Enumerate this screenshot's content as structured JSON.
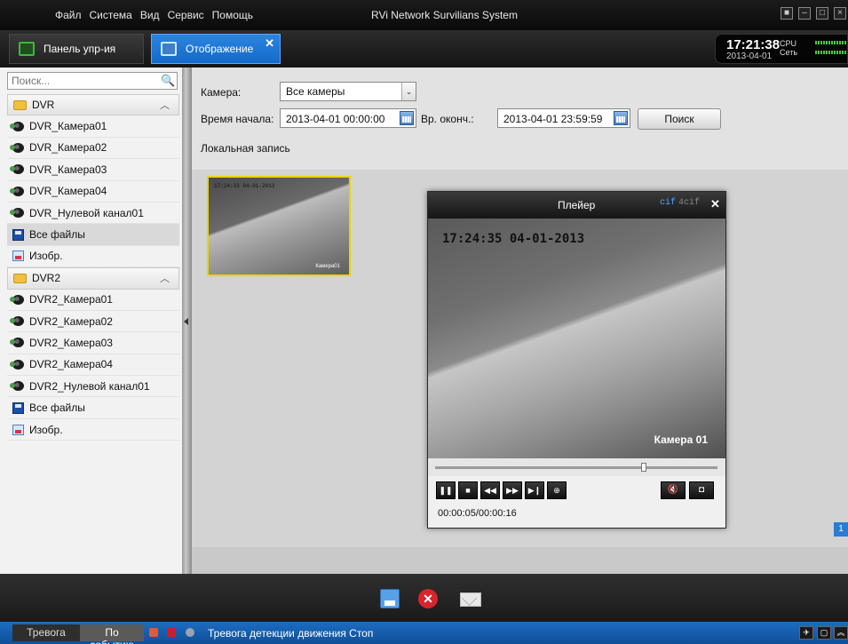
{
  "titlebar": {
    "menu": [
      "Файл",
      "Система",
      "Вид",
      "Сервис",
      "Помощь"
    ],
    "app_title": "RVi Network Survilians System"
  },
  "tabs": [
    {
      "label": "Панель упр-ия",
      "icon": "monitor-icon"
    },
    {
      "label": "Отображение",
      "icon": "display-icon",
      "active": true
    }
  ],
  "clock": {
    "time": "17:21:38",
    "date": "2013-04-01",
    "cpu_label": "CPU",
    "net_label": "Сеть"
  },
  "sidebar": {
    "search_placeholder": "Поиск...",
    "items": [
      {
        "label": "DVR",
        "type": "group"
      },
      {
        "label": "DVR_Камера01",
        "type": "camera"
      },
      {
        "label": "DVR_Камера02",
        "type": "camera"
      },
      {
        "label": "DVR_Камера03",
        "type": "camera"
      },
      {
        "label": "DVR_Камера04",
        "type": "camera"
      },
      {
        "label": "DVR_Нулевой канал01",
        "type": "camera"
      },
      {
        "label": "Все файлы",
        "type": "files",
        "selected": true
      },
      {
        "label": "Изобр.",
        "type": "images"
      },
      {
        "label": "DVR2",
        "type": "group"
      },
      {
        "label": "DVR2_Камера01",
        "type": "camera"
      },
      {
        "label": "DVR2_Камера02",
        "type": "camera"
      },
      {
        "label": "DVR2_Камера03",
        "type": "camera"
      },
      {
        "label": "DVR2_Камера04",
        "type": "camera"
      },
      {
        "label": "DVR2_Нулевой канал01",
        "type": "camera"
      },
      {
        "label": "Все файлы",
        "type": "files"
      },
      {
        "label": "Изобр.",
        "type": "images"
      }
    ]
  },
  "filter": {
    "camera_label": "Камера:",
    "camera_value": "Все камеры",
    "start_label": "Время начала:",
    "start_value": "2013-04-01 00:00:00",
    "end_label": "Вр. оконч.:",
    "end_value": "2013-04-01 23:59:59",
    "search_button": "Поиск",
    "section_title": "Локальная запись"
  },
  "thumbnail": {
    "osd": "17:24:33 04-01-2013",
    "camera": "Камера01"
  },
  "pager": {
    "page": "1"
  },
  "player": {
    "title": "Плейер",
    "res_cif": "cif",
    "res_4cif": "4cif",
    "osd": "17:24:35 04-01-2013",
    "camera_label": "Камера 01",
    "progress": 0.74,
    "time": "00:00:05/00:00:16"
  },
  "status": {
    "alarm_tab": "Тревога",
    "event_tab": "По событию",
    "message": "Тревога детекции движения Стоп"
  }
}
